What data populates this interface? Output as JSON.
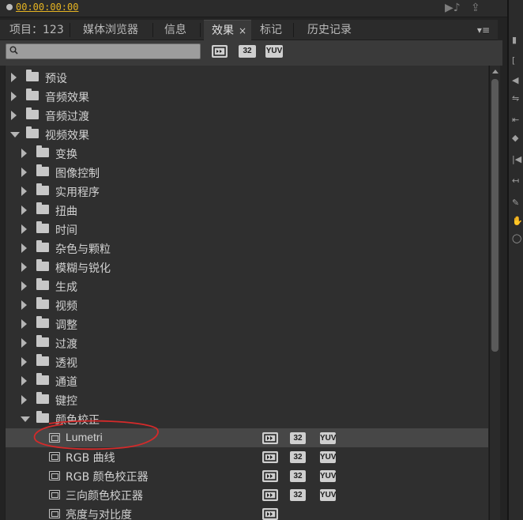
{
  "top": {
    "timecode": "00:00:00:00"
  },
  "tabs": [
    {
      "label": "项目：123"
    },
    {
      "label": "媒体浏览器"
    },
    {
      "label": "信息"
    },
    {
      "label": "效果",
      "close": "×"
    },
    {
      "label": "标记"
    },
    {
      "label": "历史记录"
    }
  ],
  "tab_menu": "▾≡",
  "toolbar": {
    "search_value": "",
    "badge_32": "32",
    "badge_yuv": "YUV"
  },
  "tree": [
    {
      "label": "预设"
    },
    {
      "label": "音频效果"
    },
    {
      "label": "音频过渡"
    },
    {
      "label": "视频效果"
    },
    {
      "label": "变换"
    },
    {
      "label": "图像控制"
    },
    {
      "label": "实用程序"
    },
    {
      "label": "扭曲"
    },
    {
      "label": "时间"
    },
    {
      "label": "杂色与颗粒"
    },
    {
      "label": "模糊与锐化"
    },
    {
      "label": "生成"
    },
    {
      "label": "视频"
    },
    {
      "label": "调整"
    },
    {
      "label": "过渡"
    },
    {
      "label": "透视"
    },
    {
      "label": "通道"
    },
    {
      "label": "键控"
    },
    {
      "label": "颜色校正"
    },
    {
      "label": "Lumetri"
    },
    {
      "label": "RGB 曲线"
    },
    {
      "label": "RGB 颜色校正器"
    },
    {
      "label": "三向颜色校正器"
    },
    {
      "label": "亮度与对比度"
    }
  ],
  "badges": {
    "b32": "32",
    "yuv": "YUV"
  },
  "colors": {
    "accent_timecode": "#e6b422",
    "annotation": "#d42a2a",
    "selected_row": "#474747"
  }
}
